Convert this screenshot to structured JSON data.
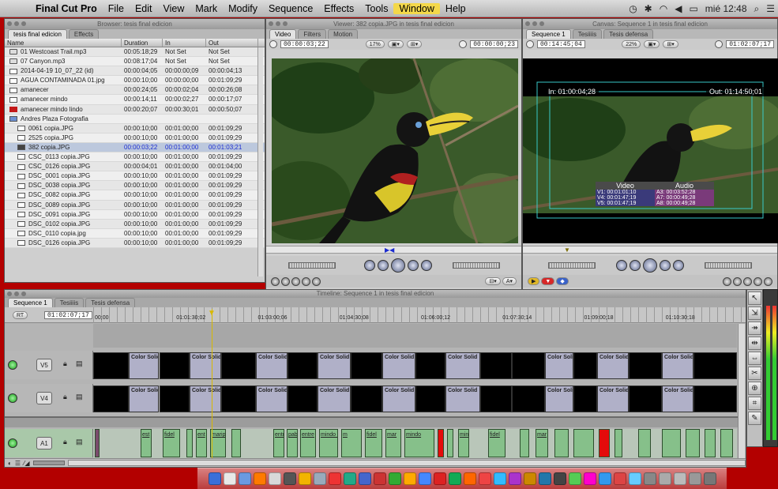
{
  "menubar": {
    "app_name": "Final Cut Pro",
    "items": [
      "File",
      "Edit",
      "View",
      "Mark",
      "Modify",
      "Sequence",
      "Effects",
      "Tools",
      "Window",
      "Help"
    ],
    "highlighted": "Window",
    "clock": "mié 12:48"
  },
  "browser": {
    "title": "Browser: tesis final edicion",
    "tabs": [
      "tesis final edicion",
      "Effects"
    ],
    "columns": [
      "Name",
      "Duration",
      "In",
      "Out"
    ],
    "rows": [
      {
        "icon": "aud",
        "name": "01 Westcoast Trail.mp3",
        "duration": "00:05:18;29",
        "in": "Not Set",
        "out": "Not Set"
      },
      {
        "icon": "aud",
        "name": "07 Canyon.mp3",
        "duration": "00:08:17;04",
        "in": "Not Set",
        "out": "Not Set"
      },
      {
        "icon": "img",
        "name": "2014-04-19 10_07_22 (id)",
        "duration": "00:00:04;05",
        "in": "00:00:00;09",
        "out": "00:00:04;13"
      },
      {
        "icon": "img",
        "name": "AGUA CONTAMINADA 01.jpg",
        "duration": "00:00:10;00",
        "in": "00:00:00;00",
        "out": "00:01:09;29"
      },
      {
        "icon": "img",
        "name": "amanecer",
        "duration": "00:00:24;05",
        "in": "00:00:02;04",
        "out": "00:00:26;08"
      },
      {
        "icon": "img",
        "name": "amanecer mindo",
        "duration": "00:00:14;11",
        "in": "00:00:02;27",
        "out": "00:00:17;07"
      },
      {
        "icon": "red",
        "name": "amanecer mindo lindo",
        "duration": "00:00:20;07",
        "in": "00:00:30;01",
        "out": "00:00:50;07"
      },
      {
        "icon": "bin",
        "name": "Andres Plaza Fotografia",
        "duration": "",
        "in": "",
        "out": ""
      },
      {
        "icon": "img",
        "name": "0061 copia.JPG",
        "duration": "00:00:10;00",
        "in": "00:01:00;00",
        "out": "00:01:09;29"
      },
      {
        "icon": "img",
        "name": "2525 copia.JPG",
        "duration": "00:00:10;00",
        "in": "00:01:00;00",
        "out": "00:01:09;29"
      },
      {
        "icon": "seq",
        "name": "382 copia.JPG",
        "duration": "00:00:03;22",
        "in": "00:01:00;00",
        "out": "00:01:03;21",
        "selected": true
      },
      {
        "icon": "img",
        "name": "CSC_0113 copia.JPG",
        "duration": "00:00:10;00",
        "in": "00:01:00;00",
        "out": "00:01:09;29"
      },
      {
        "icon": "img",
        "name": "CSC_0126 copia.JPG",
        "duration": "00:00:04;01",
        "in": "00:01:00;00",
        "out": "00:01:04;00"
      },
      {
        "icon": "img",
        "name": "DSC_0001 copia.JPG",
        "duration": "00:00:10;00",
        "in": "00:01:00;00",
        "out": "00:01:09;29"
      },
      {
        "icon": "img",
        "name": "DSC_0038 copia.JPG",
        "duration": "00:00:10;00",
        "in": "00:01:00;00",
        "out": "00:01:09;29"
      },
      {
        "icon": "img",
        "name": "DSC_0082 copia.JPG",
        "duration": "00:00:10;00",
        "in": "00:01:00;00",
        "out": "00:01:09;29"
      },
      {
        "icon": "img",
        "name": "DSC_0089 copia.JPG",
        "duration": "00:00:10;00",
        "in": "00:01:00;00",
        "out": "00:01:09;29"
      },
      {
        "icon": "img",
        "name": "DSC_0091 copia.JPG",
        "duration": "00:00:10;00",
        "in": "00:01:00;00",
        "out": "00:01:09;29"
      },
      {
        "icon": "img",
        "name": "DSC_0102 copia.JPG",
        "duration": "00:00:10;00",
        "in": "00:01:00;00",
        "out": "00:01:09;29"
      },
      {
        "icon": "img",
        "name": "DSC_0110 copia.jpg",
        "duration": "00:00:10;00",
        "in": "00:01:00;00",
        "out": "00:01:09;29"
      },
      {
        "icon": "img",
        "name": "DSC_0126 copia.JPG",
        "duration": "00:00:10;00",
        "in": "00:01:00;00",
        "out": "00:01:09;29"
      }
    ]
  },
  "viewer": {
    "title": "Viewer: 382 copia.JPG in tesis final edicion",
    "tabs": [
      "Video",
      "Filters",
      "Motion"
    ],
    "timecode_left": "00:00:03;22",
    "zoom": "17%",
    "timecode_right": "00:00:00;23"
  },
  "canvas": {
    "title": "Canvas: Sequence 1 in tesis final edicion",
    "tabs": [
      "Sequence 1",
      "Tesiiiis",
      "Tesis defensa"
    ],
    "timecode_left": "00:14:45;04",
    "zoom": "22%",
    "timecode_right": "01:02:07;17",
    "in_label": "In: 01:00:04;28",
    "out_label": "Out: 01:14:50;01",
    "overlay_video_title": "Video",
    "overlay_audio_title": "Audio",
    "overlay_video": [
      "V1: 00:01:01;10",
      "V4: 00:01:47;19",
      "V5: 00:01:47;19"
    ],
    "overlay_audio": [
      "A3: 00:03:52;28",
      "A7: 00:00:49;28",
      "A8: 00:00:49;28"
    ]
  },
  "timeline": {
    "title": "Timeline: Sequence 1 in tesis final edicion",
    "tabs": [
      "Sequence 1",
      "Tesiiiis",
      "Tesis defensa"
    ],
    "rt_label": "RT",
    "current_tc": "01:02:07;17",
    "ruler": [
      "00;00",
      "01:01:30;02",
      "01:03:00;06",
      "01:04:30;08",
      "01:06:00;12",
      "01:07:30;14",
      "01:09:00;18",
      "01:10:30;18"
    ],
    "tracks": [
      {
        "label": "V5"
      },
      {
        "label": "V4"
      },
      {
        "label": "A1"
      }
    ],
    "clip_label": "Color Solid",
    "audio_clip_labels": [
      "est",
      "fidel",
      "ent",
      "maripo",
      "entrev",
      "pablo",
      "entre",
      "mindo lindo",
      "m",
      "fidel",
      "mar",
      "mindo",
      "mindo",
      "fidel",
      "mar"
    ]
  },
  "colors": {
    "accent_yellow": "#f4d84a",
    "selection": "#bcc8dd",
    "video_clip": "#b0b0c8",
    "audio_clip": "#86c08a",
    "desktop": "#b30000"
  }
}
